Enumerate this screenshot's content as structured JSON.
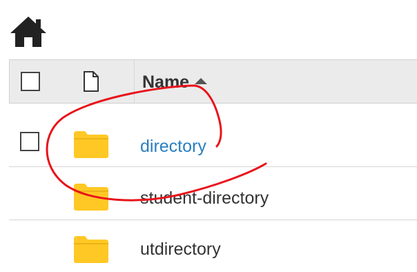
{
  "header": {
    "home_icon": "home-icon",
    "name_label": "Name",
    "sort_direction": "ascending"
  },
  "rows": [
    {
      "name": "directory",
      "type": "folder",
      "is_link": true,
      "has_checkbox": true
    },
    {
      "name": "student-directory",
      "type": "folder",
      "is_link": false,
      "has_checkbox": false
    },
    {
      "name": "utdirectory",
      "type": "folder",
      "is_link": false,
      "has_checkbox": false
    }
  ],
  "colors": {
    "link": "#2a7fc1",
    "folder": "#ffc825",
    "annotation": "#e8131b",
    "header_bg": "#ebebeb"
  }
}
